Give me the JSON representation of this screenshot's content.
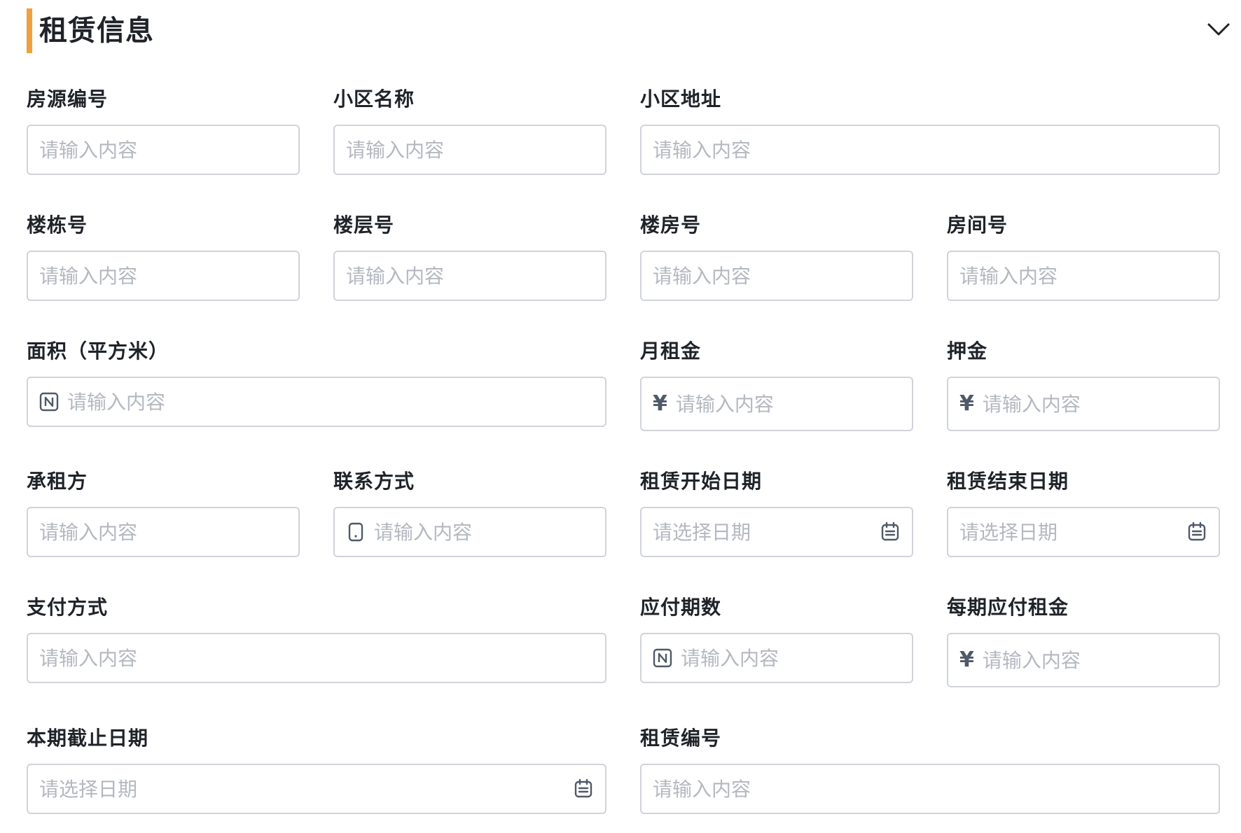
{
  "section": {
    "title": "租赁信息",
    "accent_color": "#f0a03c",
    "collapse_icon": "chevron-down-icon"
  },
  "fields": {
    "house_id": {
      "label": "房源编号",
      "placeholder": "请输入内容"
    },
    "community_name": {
      "label": "小区名称",
      "placeholder": "请输入内容"
    },
    "community_address": {
      "label": "小区地址",
      "placeholder": "请输入内容"
    },
    "building_no": {
      "label": "楼栋号",
      "placeholder": "请输入内容"
    },
    "floor_no": {
      "label": "楼层号",
      "placeholder": "请输入内容"
    },
    "house_no": {
      "label": "楼房号",
      "placeholder": "请输入内容"
    },
    "room_no": {
      "label": "房间号",
      "placeholder": "请输入内容"
    },
    "area": {
      "label": "面积（平方米）",
      "placeholder": "请输入内容",
      "icon": "number-icon"
    },
    "monthly_rent": {
      "label": "月租金",
      "placeholder": "请输入内容",
      "prefix": "¥"
    },
    "deposit": {
      "label": "押金",
      "placeholder": "请输入内容",
      "prefix": "¥"
    },
    "tenant": {
      "label": "承租方",
      "placeholder": "请输入内容"
    },
    "contact": {
      "label": "联系方式",
      "placeholder": "请输入内容",
      "icon": "phone-icon"
    },
    "lease_start": {
      "label": "租赁开始日期",
      "placeholder": "请选择日期",
      "icon": "calendar-icon"
    },
    "lease_end": {
      "label": "租赁结束日期",
      "placeholder": "请选择日期",
      "icon": "calendar-icon"
    },
    "payment_method": {
      "label": "支付方式",
      "placeholder": "请输入内容"
    },
    "payment_periods": {
      "label": "应付期数",
      "placeholder": "请输入内容",
      "icon": "number-icon"
    },
    "rent_per_period": {
      "label": "每期应付租金",
      "placeholder": "请输入内容",
      "prefix": "¥"
    },
    "period_deadline": {
      "label": "本期截止日期",
      "placeholder": "请选择日期",
      "icon": "calendar-icon"
    },
    "lease_no": {
      "label": "租赁编号",
      "placeholder": "请输入内容"
    }
  }
}
